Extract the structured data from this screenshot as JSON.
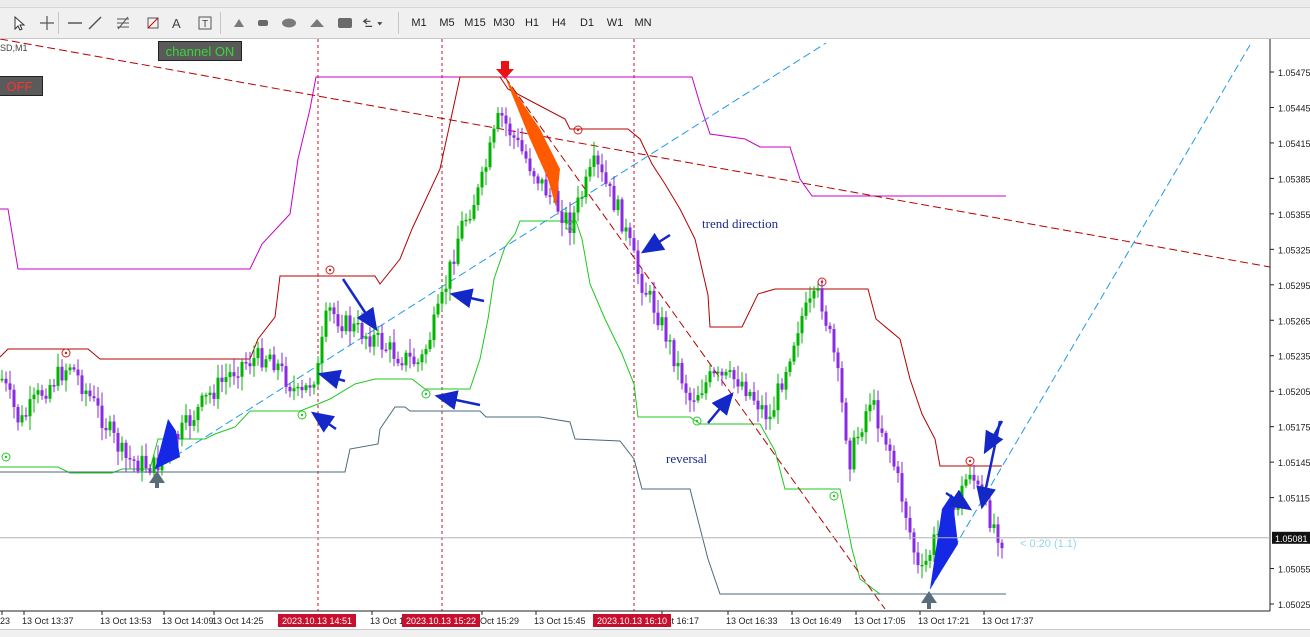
{
  "toolbar": {
    "timeframes": [
      "M1",
      "M5",
      "M15",
      "M30",
      "H1",
      "H4",
      "D1",
      "W1",
      "MN"
    ],
    "tools": [
      "cursor-icon",
      "hline-icon",
      "trendline-icon",
      "fibonacci-icon",
      "fibo-fan-icon",
      "text-label-icon",
      "text-box-icon",
      "ellipse-icon",
      "triangle-icon",
      "rectangle-icon",
      "arrows-icon"
    ]
  },
  "chart": {
    "symbol_label": "SD,M1",
    "channel_btn": "channel ON",
    "off_btn": "OFF",
    "annotations": {
      "trend": "trend direction",
      "reversal": "reversal"
    },
    "price_marker": "< 0:20 (1.1)",
    "current_price": "1.05081",
    "price_axis": [
      "1.05475",
      "1.05445",
      "1.05415",
      "1.05385",
      "1.05355",
      "1.05325",
      "1.05295",
      "1.05265",
      "1.05235",
      "1.05205",
      "1.05175",
      "1.05145",
      "1.05115",
      "1.05055",
      "1.05025"
    ],
    "time_axis": [
      "23",
      "13 Oct 13:37",
      "13 Oct 13:53",
      "13 Oct 14:09",
      "13 Oct 14:25",
      "13 Oct 14:57",
      "Oct 15:29",
      "13 Oct 15:45",
      "Oct 16:17",
      "13 Oct 16:33",
      "13 Oct 16:49",
      "13 Oct 17:05",
      "13 Oct 17:21",
      "13 Oct 17:37"
    ],
    "time_highlights": [
      "2023.10.13 14:51",
      "2023.10.13 15:22",
      "2023.10.13 16:10"
    ],
    "colors": {
      "up_candle": "#00b400",
      "down_candle": "#8a2be2",
      "upper_channel": "#b40000",
      "lower_channel": "#1ec81e",
      "outer_channel": "#c800c8",
      "trendline": "#1e9be6",
      "arrow": "#1428c8",
      "highlight": "#c8102e"
    }
  }
}
